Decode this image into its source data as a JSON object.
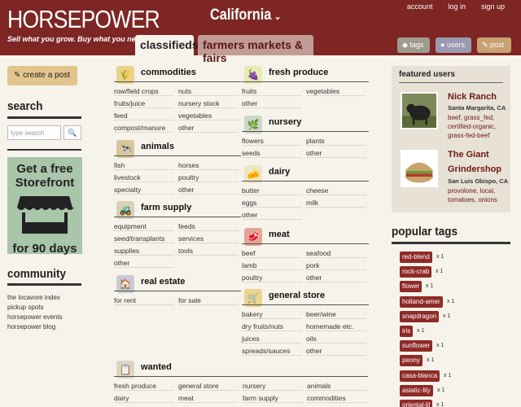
{
  "header": {
    "logo": "HORSEPOWER",
    "tagline": "Sell what you grow. Buy what you need.",
    "region": "California",
    "region_chev": "⌄",
    "links": [
      "account",
      "log in",
      "sign up"
    ],
    "tabs": [
      "classifieds",
      "farmers markets & fairs"
    ],
    "buttons": {
      "tags": "tags",
      "users": "users",
      "post": "post"
    }
  },
  "sidebar": {
    "create": "create a post",
    "search_h": "search",
    "search_ph": "type search",
    "search_icon": "🔍",
    "ad": {
      "line1": "Get a free",
      "line2": "Storefront",
      "line3": "for 90 days"
    },
    "community_h": "community",
    "community": [
      "the locavore index",
      "pickup spots",
      "horsepower events",
      "horsepower blog"
    ]
  },
  "categories": {
    "commodities": {
      "title": "commodities",
      "icon": "🌾",
      "items": [
        "row/field crops",
        "nuts",
        "fruits/juice",
        "nursery stock",
        "feed",
        "vegetables",
        "compost/manure",
        "other"
      ]
    },
    "animals": {
      "title": "animals",
      "icon": "🐄",
      "items": [
        "fish",
        "horses",
        "livestock",
        "poultry",
        "specialty",
        "other"
      ]
    },
    "farm_supply": {
      "title": "farm supply",
      "icon": "🚜",
      "items": [
        "equipment",
        "feeds",
        "seed/transplants",
        "services",
        "supplies",
        "tools",
        "other"
      ]
    },
    "real_estate": {
      "title": "real estate",
      "icon": "🏠",
      "items": [
        "for rent",
        "for sale"
      ]
    },
    "fresh_produce": {
      "title": "fresh produce",
      "icon": "🍇",
      "items": [
        "fruits",
        "vegetables",
        "other"
      ]
    },
    "nursery": {
      "title": "nursery",
      "icon": "🌿",
      "items": [
        "flowers",
        "plants",
        "seeds",
        "other"
      ]
    },
    "dairy": {
      "title": "dairy",
      "icon": "🧀",
      "items": [
        "butter",
        "cheese",
        "eggs",
        "milk",
        "other"
      ]
    },
    "meat": {
      "title": "meat",
      "icon": "🥩",
      "items": [
        "beef",
        "seafood",
        "lamb",
        "pork",
        "poultry",
        "other"
      ]
    },
    "general_store": {
      "title": "general store",
      "icon": "🛒",
      "items": [
        "bakery",
        "beer/wine",
        "dry fruits/nuts",
        "homemade etc.",
        "juices",
        "oils",
        "spreads/sauces",
        "other"
      ]
    },
    "wanted": {
      "title": "wanted",
      "icon": "📋",
      "items": [
        "fresh produce",
        "general store",
        "nursery",
        "animals",
        "dairy",
        "meat",
        "farm supply",
        "commodities"
      ]
    }
  },
  "featured": {
    "title": "featured users",
    "users": [
      {
        "name": "Nick Ranch",
        "loc": "Santa Margarita, CA",
        "desc": [
          "beef, grass_fed,",
          "certified-organic,",
          "grass-fed-beef"
        ]
      },
      {
        "name": "The Giant",
        "name2": "Grindershop",
        "loc": "San Luis Obispo, CA",
        "desc": [
          "provolone, local,",
          "tomatoes, onions"
        ]
      }
    ]
  },
  "popular": {
    "title": "popular tags",
    "tags": [
      {
        "t": "red-blend",
        "c": "x 1"
      },
      {
        "t": "rock-crab",
        "c": "x 1"
      },
      {
        "t": "flower",
        "c": "x 1"
      },
      {
        "t": "holland-amer",
        "c": "x 1"
      },
      {
        "t": "snapdragon",
        "c": "x 1"
      },
      {
        "t": "iris",
        "c": "x 1"
      },
      {
        "t": "sunflower",
        "c": "x 1"
      },
      {
        "t": "peony",
        "c": "x 1"
      },
      {
        "t": "casa-blanca",
        "c": "x 1"
      },
      {
        "t": "asiatic-lily",
        "c": "x 1"
      },
      {
        "t": "oriental-lil",
        "c": "x 1"
      }
    ]
  }
}
